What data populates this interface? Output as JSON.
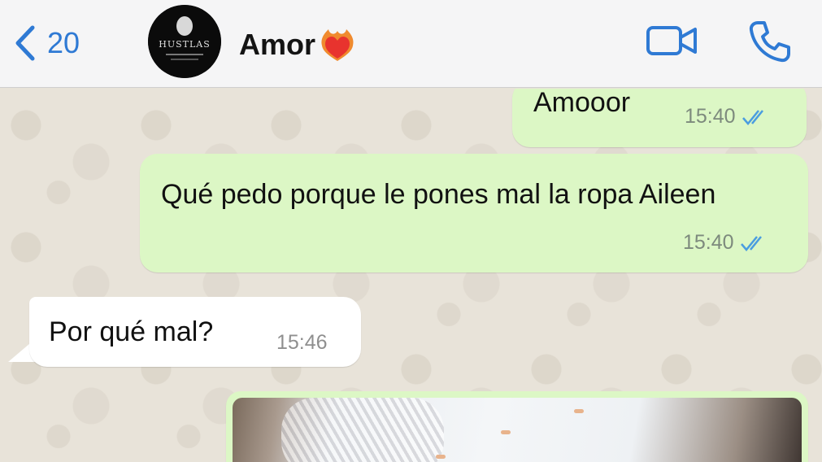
{
  "header": {
    "back_count": "20",
    "contact_name": "Amor",
    "contact_emoji": "❤️‍🔥",
    "avatar_text": "HUSTLAS",
    "icons": {
      "back": "chevron-left-icon",
      "video": "video-camera-icon",
      "call": "phone-icon"
    },
    "accent_color": "#2f7ad4"
  },
  "messages": [
    {
      "direction": "outgoing",
      "text": "Amooor",
      "time": "15:40",
      "status": "read"
    },
    {
      "direction": "outgoing",
      "text": "Qué pedo porque le pones mal la ropa Aileen",
      "time": "15:40",
      "status": "read"
    },
    {
      "direction": "incoming",
      "text": "Por qué mal?",
      "time": "15:46"
    },
    {
      "direction": "outgoing",
      "type": "image"
    }
  ],
  "colors": {
    "outgoing_bubble": "#dcf7c5",
    "incoming_bubble": "#ffffff",
    "read_ticks": "#4a9de0"
  }
}
